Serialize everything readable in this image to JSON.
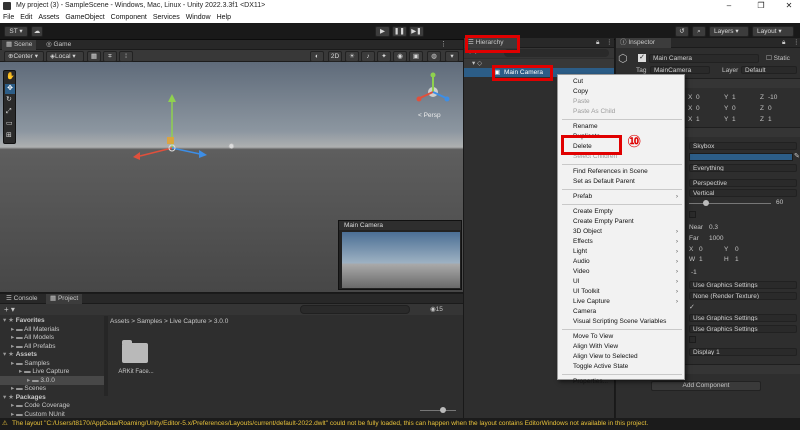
{
  "window": {
    "title": "My project (3) - SampleScene - Windows, Mac, Linux - Unity 2022.3.3f1 <DX11>",
    "controls": [
      "–",
      "❐",
      "✕"
    ]
  },
  "menu": [
    "File",
    "Edit",
    "Assets",
    "GameObject",
    "Component",
    "Services",
    "Window",
    "Help"
  ],
  "toolbar": {
    "account": "ST ▾",
    "layers": "Layers",
    "layout": "Layout"
  },
  "scene": {
    "tabs": [
      "Scene",
      "Game"
    ],
    "pivot": "Center",
    "space": "Local",
    "mode_2d": "2D",
    "persp_label": "< Persp",
    "preview_title": "Main Camera"
  },
  "hierarchy": {
    "tab": "Hierarchy",
    "selected_item": "Main Camera"
  },
  "context_menu": {
    "items": [
      {
        "label": "Cut",
        "disabled": false
      },
      {
        "label": "Copy",
        "disabled": false
      },
      {
        "label": "Paste",
        "disabled": true
      },
      {
        "label": "Paste As Child",
        "disabled": true
      },
      {
        "label": "Rename",
        "disabled": false
      },
      {
        "label": "Duplicate",
        "disabled": false
      },
      {
        "label": "Delete",
        "disabled": false
      },
      {
        "label": "Select Children",
        "disabled": true
      },
      {
        "label": "Find References in Scene",
        "disabled": false
      },
      {
        "label": "Set as Default Parent",
        "disabled": false
      },
      {
        "label": "Prefab",
        "disabled": false
      },
      {
        "label": "Create Empty",
        "disabled": false
      },
      {
        "label": "Create Empty Parent",
        "disabled": false
      },
      {
        "label": "3D Object",
        "disabled": false
      },
      {
        "label": "Effects",
        "disabled": false
      },
      {
        "label": "Light",
        "disabled": false
      },
      {
        "label": "Audio",
        "disabled": false
      },
      {
        "label": "Video",
        "disabled": false
      },
      {
        "label": "UI",
        "disabled": false
      },
      {
        "label": "UI Toolkit",
        "disabled": false
      },
      {
        "label": "Live Capture",
        "disabled": false
      },
      {
        "label": "Camera",
        "disabled": false
      },
      {
        "label": "Visual Scripting Scene Variables",
        "disabled": false
      },
      {
        "label": "Move To View",
        "disabled": false
      },
      {
        "label": "Align With View",
        "disabled": false
      },
      {
        "label": "Align View to Selected",
        "disabled": false
      },
      {
        "label": "Toggle Active State",
        "disabled": false
      },
      {
        "label": "Properties...",
        "disabled": false
      }
    ],
    "annotation_number": "⑩"
  },
  "inspector": {
    "tab": "Inspector",
    "object_name": "Main Camera",
    "static": "Static",
    "tag_label": "Tag",
    "tag_value": "MainCamera",
    "layer_label": "Layer",
    "layer_value": "Default",
    "position": {
      "x": "0",
      "y": "1",
      "z": "-10"
    },
    "rotation": {
      "x": "0",
      "y": "0",
      "z": "0"
    },
    "scale": {
      "x": "1",
      "y": "1",
      "z": "1"
    },
    "clear_flags": "Skybox",
    "culling_mask": "Everything",
    "projection": "Perspective",
    "fov_axis": "Vertical",
    "fov": "60",
    "near_label": "Near",
    "near": "0.3",
    "far_label": "Far",
    "far": "1000",
    "viewport": {
      "x": "0",
      "y": "0",
      "w": "1",
      "h": "1"
    },
    "depth": "-1",
    "rendering_path": "Use Graphics Settings",
    "target_texture": "None (Render Texture)",
    "occlusion_checkmark": "✓",
    "hdr": "Use Graphics Settings",
    "msaa": "Use Graphics Settings",
    "target_display": "Display 1",
    "add_component": "Add Component"
  },
  "project": {
    "tabs": [
      "Console",
      "Project"
    ],
    "tree": [
      {
        "label": "Favorites",
        "depth": 0,
        "bold": true
      },
      {
        "label": "All Materials",
        "depth": 1,
        "bold": false
      },
      {
        "label": "All Models",
        "depth": 1,
        "bold": false
      },
      {
        "label": "All Prefabs",
        "depth": 1,
        "bold": false
      },
      {
        "label": "Assets",
        "depth": 0,
        "bold": true
      },
      {
        "label": "Samples",
        "depth": 1,
        "bold": false
      },
      {
        "label": "Live Capture",
        "depth": 2,
        "bold": false
      },
      {
        "label": "3.0.0",
        "depth": 3,
        "bold": false
      },
      {
        "label": "Scenes",
        "depth": 1,
        "bold": false
      },
      {
        "label": "Packages",
        "depth": 0,
        "bold": true
      },
      {
        "label": "Code Coverage",
        "depth": 1,
        "bold": false
      },
      {
        "label": "Custom NUnit",
        "depth": 1,
        "bold": false
      }
    ],
    "breadcrumb": "Assets > Samples > Live Capture > 3.0.0",
    "asset_label": "ARKit Face...",
    "badge_count": "15"
  },
  "status": {
    "message": "The layout \"C:/Users/t8170/AppData/Roaming/Unity/Editor-5.x/Preferences/Layouts/current/default-2022.dwlt\" could not be fully loaded, this can happen when the layout contains EditorWindows not available in this project."
  },
  "colors": {
    "highlight": "#2c5d87",
    "annotation_red": "#e00000",
    "status_warning": "#e7c13b"
  }
}
